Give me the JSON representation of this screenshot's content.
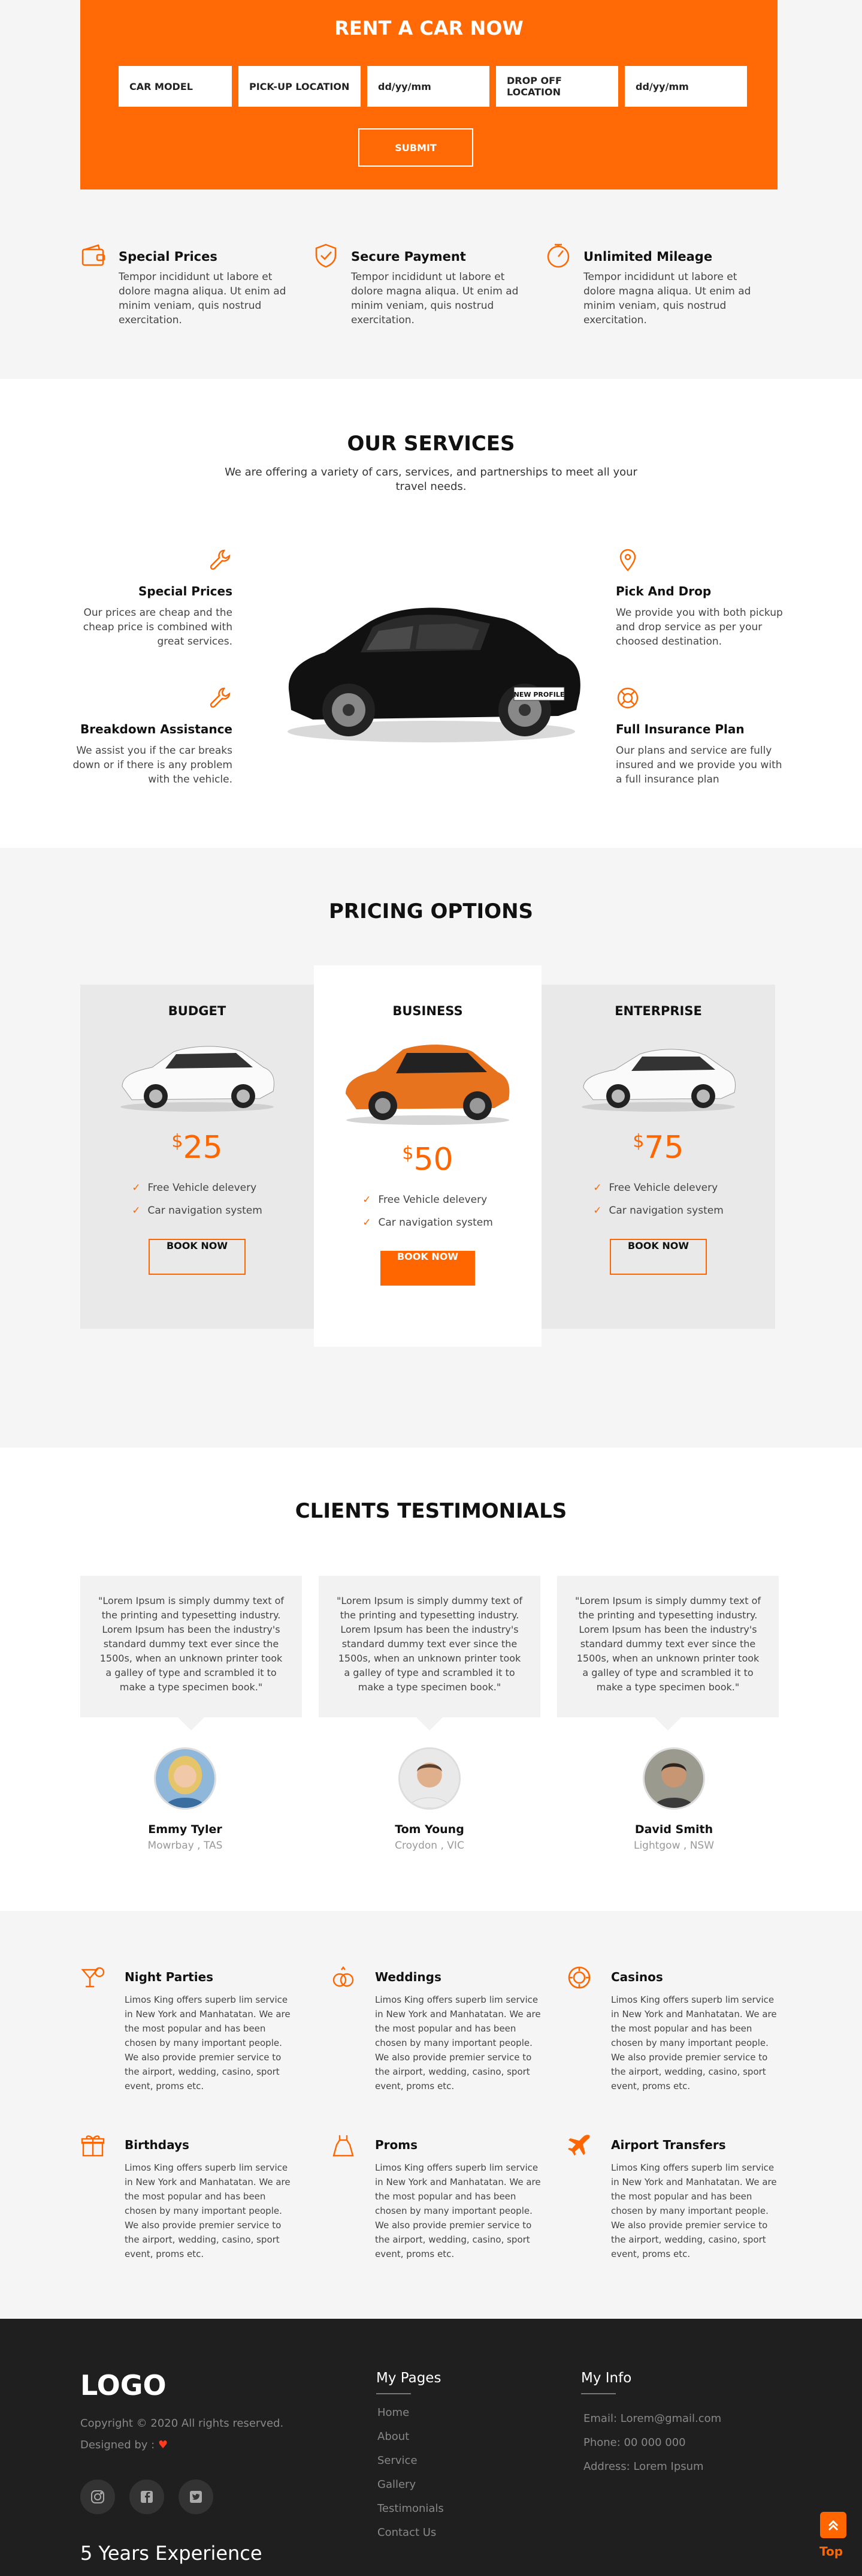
{
  "booking": {
    "title": "RENT A CAR NOW",
    "fields": [
      "CAR MODEL",
      "PICK-UP LOCATION",
      "dd/yy/mm",
      "DROP OFF LOCATION",
      "dd/yy/mm"
    ],
    "submit_label": "SUBMIT",
    "features": [
      {
        "title": "Special Prices",
        "text": "Tempor incididunt ut labore et dolore magna aliqua. Ut enim ad minim veniam, quis nostrud exercitation.",
        "icon": "wallet-icon"
      },
      {
        "title": "Secure Payment",
        "text": "Tempor incididunt ut labore et dolore magna aliqua. Ut enim ad minim veniam, quis nostrud exercitation.",
        "icon": "shield-check-icon"
      },
      {
        "title": "Unlimited Mileage",
        "text": "Tempor incididunt ut labore et dolore magna aliqua. Ut enim ad minim veniam, quis nostrud exercitation.",
        "icon": "speedometer-icon"
      }
    ]
  },
  "services": {
    "title": "OUR SERVICES",
    "subtitle": "We are offering a variety of cars, services, and partnerships to meet all your travel needs.",
    "items": [
      {
        "title": "Special Prices",
        "text": "Our prices are cheap and the cheap price is combined with great services.",
        "icon": "wrench-icon"
      },
      {
        "title": "Breakdown Assistance",
        "text": "We assist you if the car breaks down or if there is any problem with the vehicle.",
        "icon": "wrench-icon"
      },
      {
        "title": "Pick And Drop",
        "text": "We provide you with both pickup and drop service as per your choosed destination.",
        "icon": "location-pin-icon"
      },
      {
        "title": "Full Insurance Plan",
        "text": "Our plans and service are fully insured and we provide you with a full insurance plan",
        "icon": "lifebuoy-icon"
      }
    ],
    "car_plate": "NEW PROFILE"
  },
  "pricing": {
    "title": "PRICING OPTIONS",
    "currency": "$",
    "plans": [
      {
        "name": "BUDGET",
        "price": "25",
        "features": [
          "Free Vehicle delevery",
          "Car navigation system"
        ],
        "button": "BOOK NOW",
        "car_color": "#ffffff"
      },
      {
        "name": "BUSINESS",
        "price": "50",
        "features": [
          "Free Vehicle delevery",
          "Car navigation system"
        ],
        "button": "BOOK NOW",
        "car_color": "#e8731f"
      },
      {
        "name": "ENTERPRISE",
        "price": "75",
        "features": [
          "Free Vehicle delevery",
          "Car navigation system"
        ],
        "button": "BOOK NOW",
        "car_color": "#ffffff"
      }
    ]
  },
  "testimonials": {
    "title": "CLIENTS TESTIMONIALS",
    "items": [
      {
        "quote": "\"Lorem Ipsum is simply dummy text of the printing and typesetting industry. Lorem Ipsum has been the industry's standard dummy text ever since the 1500s, when an unknown printer took a galley of type and scrambled it to make a type specimen book.\"",
        "name": "Emmy Tyler",
        "location": "Mowrbay , TAS"
      },
      {
        "quote": "\"Lorem Ipsum is simply dummy text of the printing and typesetting industry. Lorem Ipsum has been the industry's standard dummy text ever since the 1500s, when an unknown printer took a galley of type and scrambled it to make a type specimen book.\"",
        "name": "Tom Young",
        "location": "Croydon , VIC"
      },
      {
        "quote": "\"Lorem Ipsum is simply dummy text of the printing and typesetting industry. Lorem Ipsum has been the industry's standard dummy text ever since the 1500s, when an unknown printer took a galley of type and scrambled it to make a type specimen book.\"",
        "name": "David Smith",
        "location": "Lightgow , NSW"
      }
    ]
  },
  "events": {
    "text": "Limos King offers superb lim service in New York and Manhatatan.  We are the most popular and has been chosen by many important people. We also provide premier service to the airport, wedding, casino, sport event, proms etc.",
    "items": [
      {
        "title": "Night Parties",
        "icon": "cocktail-icon"
      },
      {
        "title": "Weddings",
        "icon": "rings-icon"
      },
      {
        "title": "Casinos",
        "icon": "casino-chip-icon"
      },
      {
        "title": "Birthdays",
        "icon": "gift-icon"
      },
      {
        "title": "Proms",
        "icon": "dress-icon"
      },
      {
        "title": "Airport Transfers",
        "icon": "airplane-icon"
      }
    ]
  },
  "footer": {
    "logo": "LOGO",
    "copyright": "Copyright © 2020 All rights reserved.",
    "designed_by": "Designed by :",
    "years": "5 Years Experience",
    "pages_title": "My Pages",
    "pages": [
      "Home",
      "About",
      "Service",
      "Gallery",
      "Testimonials",
      "Contact Us"
    ],
    "info_title": "My Info",
    "info": [
      "Email: Lorem@gmail.com",
      "Phone: 00 000 000",
      "Address: Lorem Ipsum"
    ],
    "socials": [
      "instagram-icon",
      "facebook-icon",
      "twitter-icon"
    ],
    "top_label": "Top"
  }
}
